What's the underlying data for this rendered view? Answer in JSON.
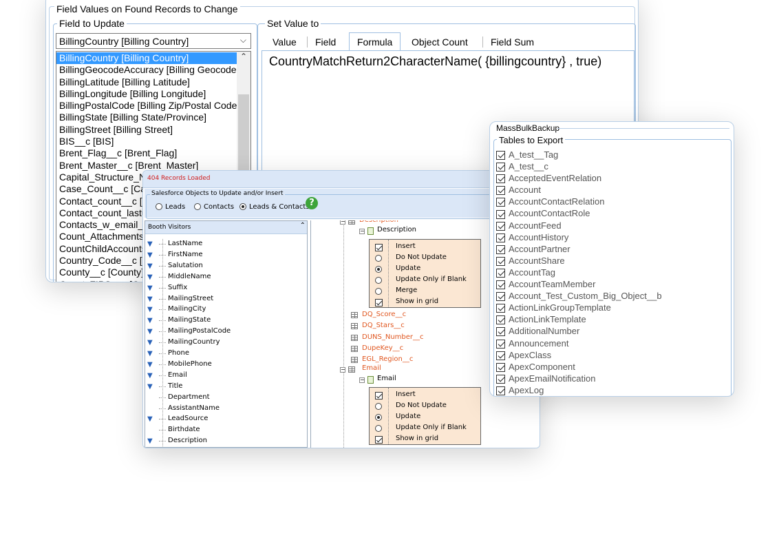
{
  "window1": {
    "group_title": "Field Values on Found Records to Change",
    "field_to_update": {
      "title": "Field to Update",
      "selected": "BillingCountry [Billing Country]",
      "items": [
        "BillingCountry [Billing Country]",
        "BillingGeocodeAccuracy [Billing Geocode",
        "BillingLatitude [Billing Latitude]",
        "BillingLongitude [Billing Longitude]",
        "BillingPostalCode [Billing Zip/Postal Code",
        "BillingState [Billing State/Province]",
        "BillingStreet [Billing Street]",
        "BIS__c [BIS]",
        "Brent_Flag__c [Brent_Flag]",
        "Brent_Master__c [Brent_Master]",
        "Capital_Structure_N",
        "Case_Count__c [Ca",
        "Contact_count__c [",
        "Contact_count_lastu",
        "Contacts_w_email_a",
        "Count_Attachments",
        "CountChildAccounts",
        "Country_Code__c [C",
        "County__c [County]",
        "CountyFIPS__c [Co"
      ]
    },
    "set_value": {
      "title": "Set Value to",
      "tabs": [
        "Value",
        "Field",
        "Formula",
        "Object Count",
        "Field Sum"
      ],
      "active_tab": "Formula",
      "formula": "CountryMatchReturn2CharacterName( {billingcountry} , true)"
    }
  },
  "window2": {
    "status": "404 Records Loaded",
    "objects_group_title": "Salesforce Objects to Update and/or Insert",
    "radios": [
      {
        "label": "Leads",
        "checked": false
      },
      {
        "label": "Contacts",
        "checked": false
      },
      {
        "label": "Leads & Contacts",
        "checked": true
      }
    ],
    "help_icon": "question-circle-icon",
    "list_header": "Booth Visitors",
    "fields": [
      {
        "name": "LastName",
        "pinned": true
      },
      {
        "name": "FirstName",
        "pinned": true
      },
      {
        "name": "Salutation",
        "pinned": true
      },
      {
        "name": "MiddleName",
        "pinned": true
      },
      {
        "name": "Suffix",
        "pinned": true
      },
      {
        "name": "MailingStreet",
        "pinned": true
      },
      {
        "name": "MailingCity",
        "pinned": true
      },
      {
        "name": "MailingState",
        "pinned": true
      },
      {
        "name": "MailingPostalCode",
        "pinned": true
      },
      {
        "name": "MailingCountry",
        "pinned": true
      },
      {
        "name": "Phone",
        "pinned": true
      },
      {
        "name": "MobilePhone",
        "pinned": true
      },
      {
        "name": "Email",
        "pinned": true
      },
      {
        "name": "Title",
        "pinned": true
      },
      {
        "name": "Department",
        "pinned": false
      },
      {
        "name": "AssistantName",
        "pinned": false
      },
      {
        "name": "LeadSource",
        "pinned": true
      },
      {
        "name": "Birthdate",
        "pinned": false
      },
      {
        "name": "Description",
        "pinned": true
      }
    ],
    "tree": {
      "top_partial": "Description",
      "description_child": "Description",
      "options_1": [
        {
          "type": "check",
          "label": "Insert",
          "on": true
        },
        {
          "type": "radio",
          "label": "Do Not Update",
          "on": false
        },
        {
          "type": "radio",
          "label": "Update",
          "on": true
        },
        {
          "type": "radio",
          "label": "Update Only if Blank",
          "on": false
        },
        {
          "type": "radio",
          "label": "Merge",
          "on": false
        },
        {
          "type": "check",
          "label": "Show in grid",
          "on": true
        }
      ],
      "other_fields": [
        "DQ_Score__c",
        "DQ_Stars__c",
        "DUNS_Number__c",
        "DupeKey__c",
        "EGL_Region__c"
      ],
      "email_node": "Email",
      "email_child": "Email",
      "options_2": [
        {
          "type": "check",
          "label": "Insert",
          "on": true
        },
        {
          "type": "radio",
          "label": "Do Not Update",
          "on": false
        },
        {
          "type": "radio",
          "label": "Update",
          "on": true
        },
        {
          "type": "radio",
          "label": "Update Only if Blank",
          "on": false
        },
        {
          "type": "check",
          "label": "Show in grid",
          "on": true
        }
      ]
    }
  },
  "window3": {
    "title": "MassBulkBackup",
    "group_title": "Tables to Export",
    "tables": [
      "A_test__Tag",
      "A_test__c",
      "AcceptedEventRelation",
      "Account",
      "AccountContactRelation",
      "AccountContactRole",
      "AccountFeed",
      "AccountHistory",
      "AccountPartner",
      "AccountShare",
      "AccountTag",
      "AccountTeamMember",
      "Account_Test_Custom_Big_Object__b",
      "ActionLinkGroupTemplate",
      "ActionLinkTemplate",
      "AdditionalNumber",
      "Announcement",
      "ApexClass",
      "ApexComponent",
      "ApexEmailNotification",
      "ApexLog"
    ]
  },
  "colors": {
    "selection": "#3399ff",
    "accent_border": "#9fbfe1",
    "status_red": "#d11a1a",
    "field_orange": "#e0561f",
    "option_fill": "#fbe7d3"
  }
}
